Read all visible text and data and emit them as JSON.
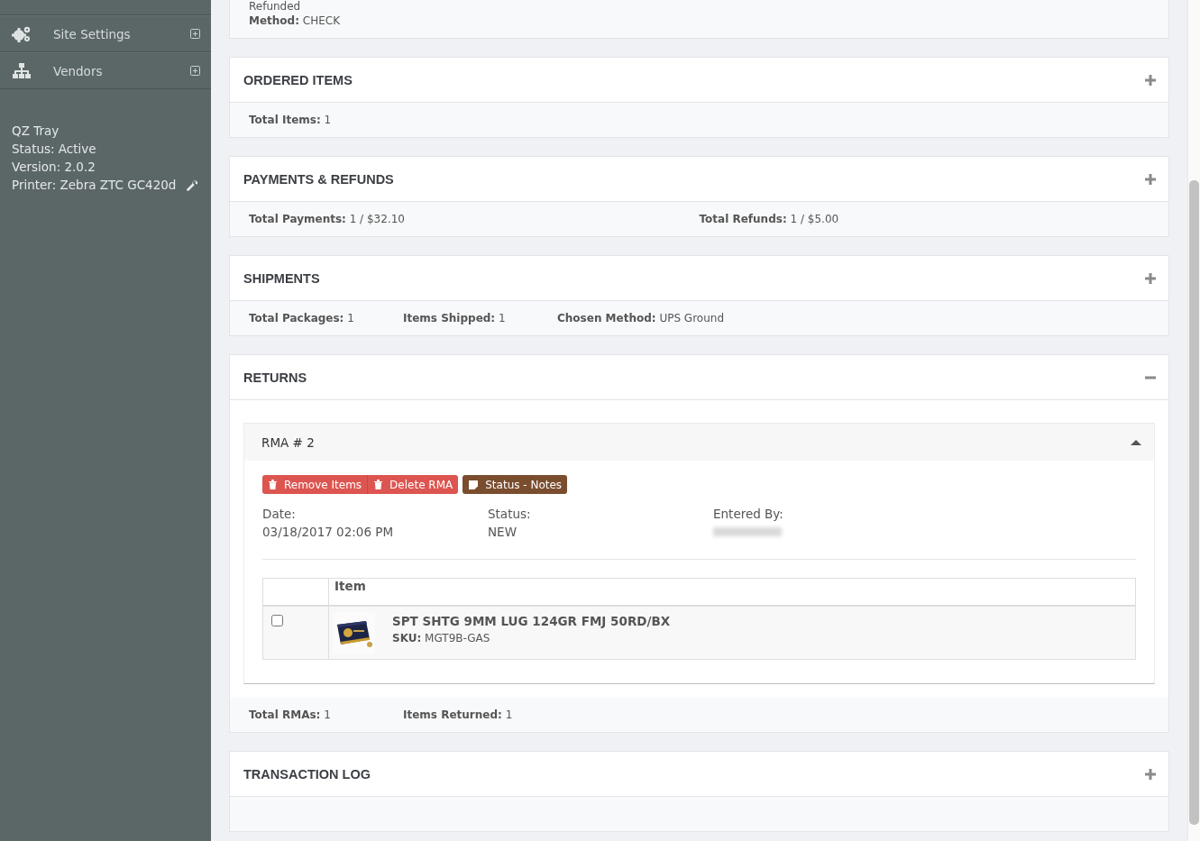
{
  "sidebar": {
    "items": [
      {
        "label": "Site Settings"
      },
      {
        "label": "Vendors"
      }
    ],
    "status_lines": [
      {
        "text": "QZ Tray",
        "wrench": false
      },
      {
        "text": "Status: Active",
        "wrench": false
      },
      {
        "text": "Version: 2.0.2",
        "wrench": false
      },
      {
        "text": "Printer: Zebra ZTC GC420d",
        "wrench": true
      }
    ]
  },
  "top_card": {
    "status": "Refunded",
    "method": {
      "label": "Method:",
      "value": "CHECK"
    }
  },
  "sections": [
    {
      "title": "ORDERED ITEMS",
      "expanded": false,
      "summary": [
        {
          "label": "Total Items:",
          "value": "1"
        }
      ]
    },
    {
      "title": "PAYMENTS & REFUNDS",
      "expanded": false,
      "summary": [
        {
          "label": "Total Payments:",
          "value": "1 / $32.10"
        },
        {
          "label": "Total Refunds:",
          "value": "1 / $5.00"
        }
      ]
    },
    {
      "title": "SHIPMENTS",
      "expanded": false,
      "summary": [
        {
          "label": "Total Packages:",
          "value": "1"
        },
        {
          "label": "Items Shipped:",
          "value": "1"
        },
        {
          "label": "Chosen Method:",
          "value": "UPS Ground"
        }
      ]
    },
    {
      "title": "RETURNS",
      "expanded": true,
      "summary": [
        {
          "label": "Total RMAs:",
          "value": "1"
        },
        {
          "label": "Items Returned:",
          "value": "1"
        }
      ],
      "rma": {
        "title": "RMA # 2",
        "expanded": true,
        "buttons": [
          {
            "label": "Remove Items",
            "kind": "danger"
          },
          {
            "label": "Delete RMA",
            "kind": "danger"
          },
          {
            "label": "Status - Notes",
            "kind": "notes"
          }
        ],
        "info": [
          {
            "label": "Date:",
            "value": "03/18/2017 02:06 PM",
            "redacted": false
          },
          {
            "label": "Status:",
            "value": "NEW",
            "redacted": false
          },
          {
            "label": "Entered By:",
            "redacted": true
          }
        ],
        "table": {
          "columns": [
            "Item"
          ],
          "rows": [
            {
              "checked": false,
              "name": "SPT SHTG 9MM LUG 124GR FMJ 50RD/BX",
              "sku_label": "SKU:",
              "sku": "MGT9B-GAS"
            }
          ]
        }
      }
    },
    {
      "title": "TRANSACTION LOG",
      "expanded": false
    }
  ]
}
